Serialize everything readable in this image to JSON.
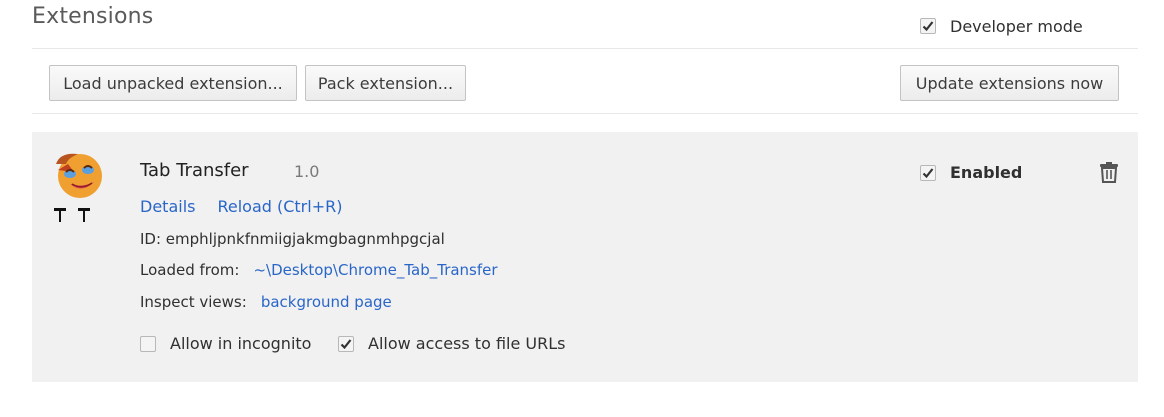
{
  "header": {
    "title": "Extensions",
    "developer_mode_label": "Developer mode",
    "developer_mode_checked": true
  },
  "toolbar": {
    "load_unpacked_label": "Load unpacked extension...",
    "pack_label": "Pack extension...",
    "update_label": "Update extensions now"
  },
  "extension": {
    "name": "Tab Transfer",
    "version": "1.0",
    "details_label": "Details",
    "reload_label": "Reload (Ctrl+R)",
    "id_text": "ID: emphljpnkfnmiigjakmgbagnmhpgcjal",
    "loaded_from_label": "Loaded from:",
    "loaded_from_path": "~\\Desktop\\Chrome_Tab_Transfer",
    "inspect_label": "Inspect views:",
    "inspect_link": "background page",
    "enabled_label": "Enabled",
    "enabled_checked": true,
    "incognito_label": "Allow in incognito",
    "incognito_checked": false,
    "file_urls_label": "Allow access to file URLs",
    "file_urls_checked": true,
    "icon": "crying-face-icon",
    "trash_icon": "trash-icon"
  },
  "colors": {
    "link": "#2a66c8",
    "card_bg": "#f1f1f1",
    "divider": "#e8e8e8"
  }
}
